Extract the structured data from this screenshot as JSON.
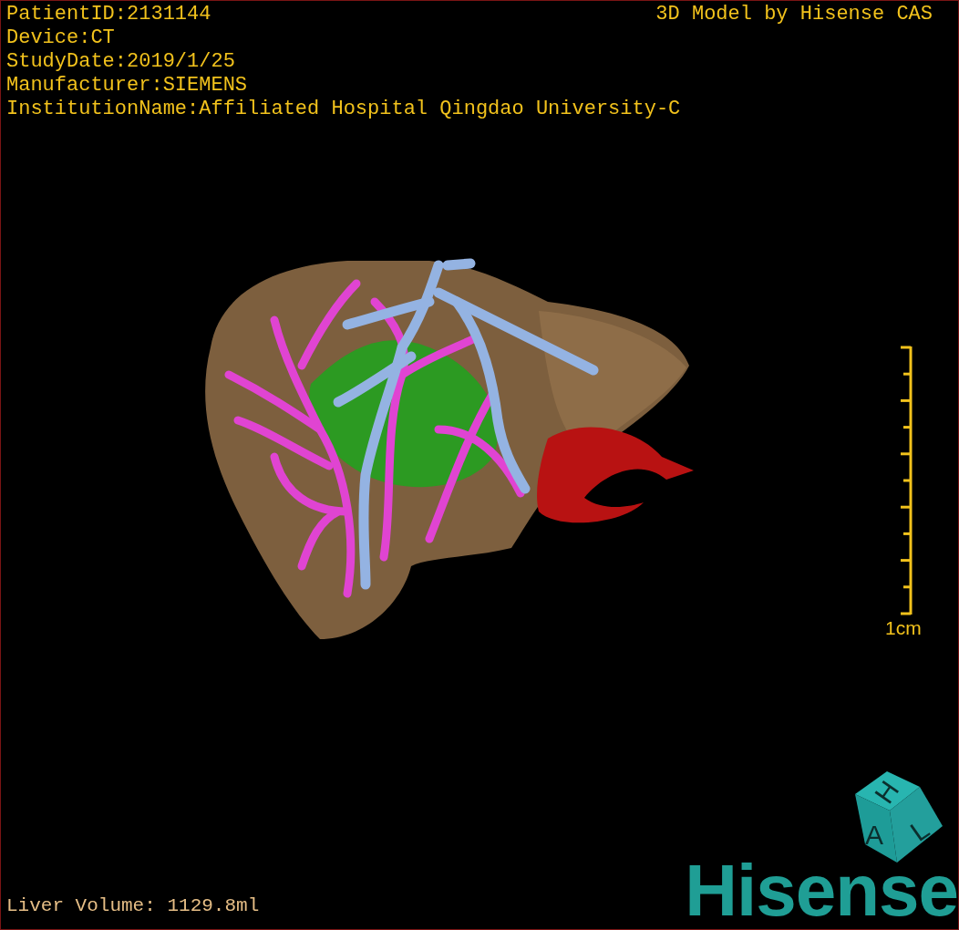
{
  "header_info": [
    "PatientID:2131144",
    "Device:CT",
    "StudyDate:2019/1/25",
    "Manufacturer:SIEMENS",
    "InstitutionName:Affiliated Hospital Qingdao University-C"
  ],
  "title": "3D Model by Hisense CAS",
  "scale_bar": {
    "label": "1cm"
  },
  "orientation_cube": {
    "faces": [
      "H",
      "A",
      "L"
    ]
  },
  "logo": "Hisense",
  "liver_volume": "Liver Volume: 1129.8ml"
}
